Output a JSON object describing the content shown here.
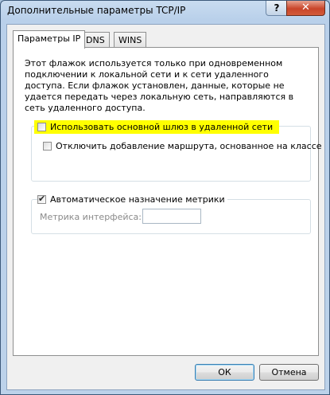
{
  "window": {
    "title": "Дополнительные параметры TCP/IP",
    "help_label": "?",
    "close_label": "✕"
  },
  "tabs": [
    {
      "label": "Параметры IP",
      "active": true
    },
    {
      "label": "DNS",
      "active": false
    },
    {
      "label": "WINS",
      "active": false
    }
  ],
  "description": "Этот флажок используется только при одновременном подключении к локальной сети и к сети удаленного доступа. Если флажок установлен, данные, которые не удается передать через локальную сеть, направляются в сеть удаленного доступа.",
  "options": {
    "use_default_gateway": {
      "label": "Использовать основной шлюз в удаленной сети",
      "checked": false
    },
    "disable_class_route": {
      "label": "Отключить добавление маршрута, основанное на классе",
      "checked": false
    },
    "automatic_metric": {
      "label": "Автоматическое назначение метрики",
      "checked": true
    },
    "interface_metric_label": "Метрика интерфейса:",
    "interface_metric_value": ""
  },
  "buttons": {
    "ok": "ОК",
    "cancel": "Отмена"
  },
  "colors": {
    "highlight": "#ffff00",
    "close_button": "#c8452a"
  }
}
